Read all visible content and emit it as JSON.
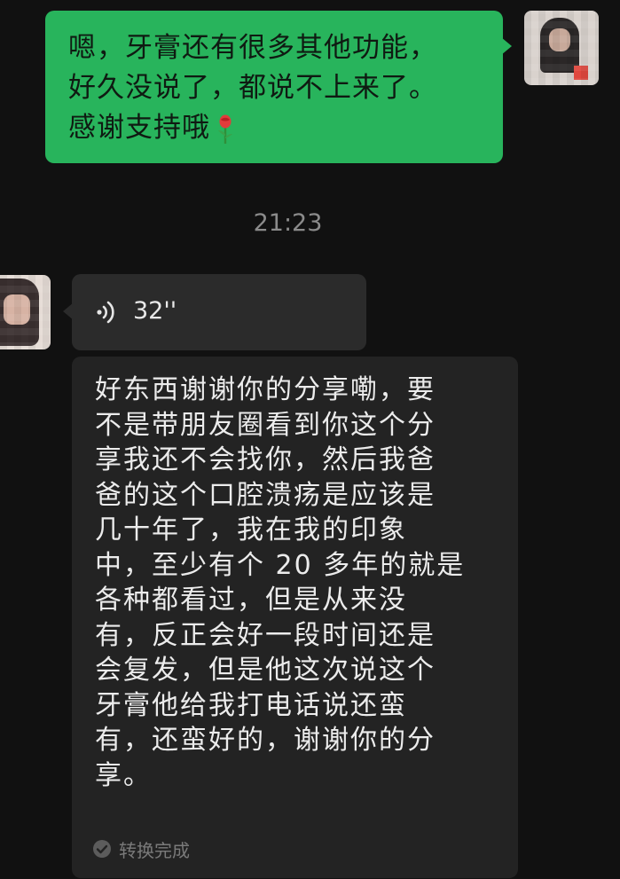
{
  "outgoing_message": {
    "lines": [
      "嗯，牙膏还有很多其他功能，",
      "好久没说了，都说不上来了。",
      "感谢支持哦"
    ],
    "emoji_icon": "rose-icon"
  },
  "timestamp": "21:23",
  "voice_message": {
    "duration": "32''",
    "icon": "voice-wave-icon"
  },
  "transcript": {
    "lines": [
      "好东西谢谢你的分享嘞，要",
      "不是带朋友圈看到你这个分",
      "享我还不会找你，然后我爸",
      "爸的这个口腔溃疡是应该是",
      "几十年了，我在我的印象",
      "中，至少有个 20 多年的就是",
      "各种都看过，但是从来没",
      "有，反正会好一段时间还是",
      "会复发，但是他这次说这个",
      "牙膏他给我打电话说还蛮",
      "有，还蛮好的，谢谢你的分",
      "享。"
    ],
    "status": "转换完成",
    "status_icon": "check-circle-icon"
  },
  "colors": {
    "background": "#111111",
    "outgoing_bubble": "#28b45c",
    "incoming_bubble": "#2b2b2b",
    "transcript_bubble": "#232323"
  }
}
